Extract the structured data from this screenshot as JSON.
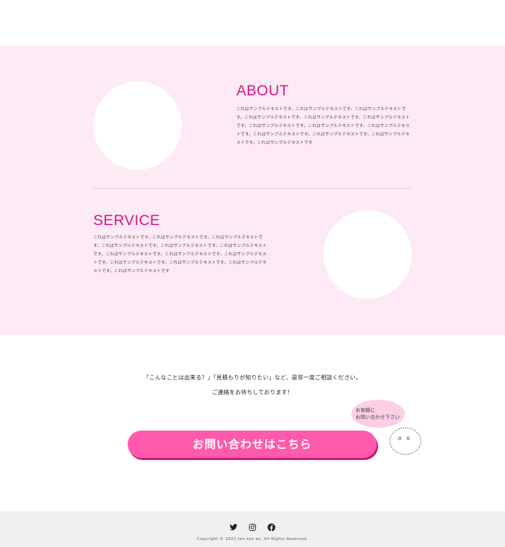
{
  "about": {
    "title": "ABOUT",
    "text": "これはサンプルテキストです。これはサンプルテキストです。これはサンプルテキストです。これはサンプルテキストです。これはサンプルテキストです。これはサンプルテキストです。これはサンプルテキストです。これはサンプルテキストです。これはサンプルテキストです。これはサンプルテキストです。これはサンプルテキストです。これはサンプルテキストです。これはサンプルテキストです"
  },
  "service": {
    "title": "SERVICE",
    "text": "これはサンプルテキストです。これはサンプルテキストです。これはサンプルテキストです。これはサンプルテキストです。これはサンプルテキストです。これはサンプルテキストです。これはサンプルテキストです。これはサンプルテキストです。これはサンプルテキストです。これはサンプルテキストです。これはサンプルテキストです。これはサンプルテキストです。これはサンプルテキストです"
  },
  "cta": {
    "line1": "「こんなことは出来る？」「見積もりが知りたい」など、是非一度ご相談ください。",
    "line2": "ご連絡をお待ちしております！",
    "button_label": "お問い合わせはこちら",
    "bubble_line1": "お気軽に",
    "bubble_line2": "お問い合わせ下さい"
  },
  "footer": {
    "social_icons": [
      "twitter-icon",
      "instagram-icon",
      "facebook-icon"
    ],
    "copyright": "Copyright © 2022 ten sen en. All Rights Reserved."
  },
  "colors": {
    "section_bg": "#fdeaf4",
    "accent": "#d4168a",
    "button": "#ff5aab",
    "footer_bg": "#eef0f1"
  }
}
